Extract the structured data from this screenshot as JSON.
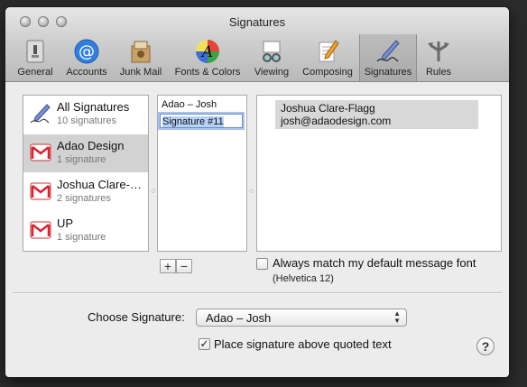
{
  "window": {
    "title": "Signatures"
  },
  "toolbar": {
    "items": [
      {
        "label": "General",
        "icon": "general-icon"
      },
      {
        "label": "Accounts",
        "icon": "accounts-icon"
      },
      {
        "label": "Junk Mail",
        "icon": "junk-mail-icon"
      },
      {
        "label": "Fonts & Colors",
        "icon": "fonts-colors-icon"
      },
      {
        "label": "Viewing",
        "icon": "viewing-icon"
      },
      {
        "label": "Composing",
        "icon": "composing-icon"
      },
      {
        "label": "Signatures",
        "icon": "signatures-icon"
      },
      {
        "label": "Rules",
        "icon": "rules-icon"
      }
    ],
    "selected": "Signatures"
  },
  "accounts": [
    {
      "name": "All Signatures",
      "count": "10 signatures",
      "icon": "signature-pen-icon"
    },
    {
      "name": "Adao Design",
      "count": "1 signature",
      "icon": "gmail-icon"
    },
    {
      "name": "Joshua Clare-…",
      "count": "2 signatures",
      "icon": "gmail-icon"
    },
    {
      "name": "UP",
      "count": "1 signature",
      "icon": "gmail-icon"
    }
  ],
  "signatures": [
    {
      "name": "Adao – Josh"
    },
    {
      "name": "Signature #11"
    }
  ],
  "editor": {
    "line1": "Joshua Clare-Flagg",
    "line2": "josh@adaodesign.com"
  },
  "buttons": {
    "add": "+",
    "remove": "−"
  },
  "font_match": {
    "label": "Always match my default message font",
    "font": "(Helvetica 12)",
    "checked": false
  },
  "choose": {
    "label": "Choose Signature:",
    "value": "Adao – Josh"
  },
  "place_above": {
    "label": "Place signature above quoted text",
    "checked": true
  },
  "help": "?"
}
